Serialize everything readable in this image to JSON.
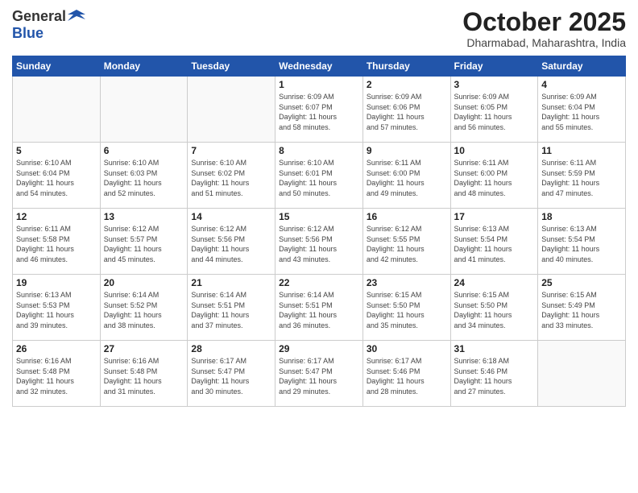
{
  "header": {
    "logo_general": "General",
    "logo_blue": "Blue",
    "month_title": "October 2025",
    "location": "Dharmabad, Maharashtra, India"
  },
  "calendar": {
    "days_of_week": [
      "Sunday",
      "Monday",
      "Tuesday",
      "Wednesday",
      "Thursday",
      "Friday",
      "Saturday"
    ],
    "weeks": [
      [
        {
          "day": "",
          "info": ""
        },
        {
          "day": "",
          "info": ""
        },
        {
          "day": "",
          "info": ""
        },
        {
          "day": "1",
          "info": "Sunrise: 6:09 AM\nSunset: 6:07 PM\nDaylight: 11 hours\nand 58 minutes."
        },
        {
          "day": "2",
          "info": "Sunrise: 6:09 AM\nSunset: 6:06 PM\nDaylight: 11 hours\nand 57 minutes."
        },
        {
          "day": "3",
          "info": "Sunrise: 6:09 AM\nSunset: 6:05 PM\nDaylight: 11 hours\nand 56 minutes."
        },
        {
          "day": "4",
          "info": "Sunrise: 6:09 AM\nSunset: 6:04 PM\nDaylight: 11 hours\nand 55 minutes."
        }
      ],
      [
        {
          "day": "5",
          "info": "Sunrise: 6:10 AM\nSunset: 6:04 PM\nDaylight: 11 hours\nand 54 minutes."
        },
        {
          "day": "6",
          "info": "Sunrise: 6:10 AM\nSunset: 6:03 PM\nDaylight: 11 hours\nand 52 minutes."
        },
        {
          "day": "7",
          "info": "Sunrise: 6:10 AM\nSunset: 6:02 PM\nDaylight: 11 hours\nand 51 minutes."
        },
        {
          "day": "8",
          "info": "Sunrise: 6:10 AM\nSunset: 6:01 PM\nDaylight: 11 hours\nand 50 minutes."
        },
        {
          "day": "9",
          "info": "Sunrise: 6:11 AM\nSunset: 6:00 PM\nDaylight: 11 hours\nand 49 minutes."
        },
        {
          "day": "10",
          "info": "Sunrise: 6:11 AM\nSunset: 6:00 PM\nDaylight: 11 hours\nand 48 minutes."
        },
        {
          "day": "11",
          "info": "Sunrise: 6:11 AM\nSunset: 5:59 PM\nDaylight: 11 hours\nand 47 minutes."
        }
      ],
      [
        {
          "day": "12",
          "info": "Sunrise: 6:11 AM\nSunset: 5:58 PM\nDaylight: 11 hours\nand 46 minutes."
        },
        {
          "day": "13",
          "info": "Sunrise: 6:12 AM\nSunset: 5:57 PM\nDaylight: 11 hours\nand 45 minutes."
        },
        {
          "day": "14",
          "info": "Sunrise: 6:12 AM\nSunset: 5:56 PM\nDaylight: 11 hours\nand 44 minutes."
        },
        {
          "day": "15",
          "info": "Sunrise: 6:12 AM\nSunset: 5:56 PM\nDaylight: 11 hours\nand 43 minutes."
        },
        {
          "day": "16",
          "info": "Sunrise: 6:12 AM\nSunset: 5:55 PM\nDaylight: 11 hours\nand 42 minutes."
        },
        {
          "day": "17",
          "info": "Sunrise: 6:13 AM\nSunset: 5:54 PM\nDaylight: 11 hours\nand 41 minutes."
        },
        {
          "day": "18",
          "info": "Sunrise: 6:13 AM\nSunset: 5:54 PM\nDaylight: 11 hours\nand 40 minutes."
        }
      ],
      [
        {
          "day": "19",
          "info": "Sunrise: 6:13 AM\nSunset: 5:53 PM\nDaylight: 11 hours\nand 39 minutes."
        },
        {
          "day": "20",
          "info": "Sunrise: 6:14 AM\nSunset: 5:52 PM\nDaylight: 11 hours\nand 38 minutes."
        },
        {
          "day": "21",
          "info": "Sunrise: 6:14 AM\nSunset: 5:51 PM\nDaylight: 11 hours\nand 37 minutes."
        },
        {
          "day": "22",
          "info": "Sunrise: 6:14 AM\nSunset: 5:51 PM\nDaylight: 11 hours\nand 36 minutes."
        },
        {
          "day": "23",
          "info": "Sunrise: 6:15 AM\nSunset: 5:50 PM\nDaylight: 11 hours\nand 35 minutes."
        },
        {
          "day": "24",
          "info": "Sunrise: 6:15 AM\nSunset: 5:50 PM\nDaylight: 11 hours\nand 34 minutes."
        },
        {
          "day": "25",
          "info": "Sunrise: 6:15 AM\nSunset: 5:49 PM\nDaylight: 11 hours\nand 33 minutes."
        }
      ],
      [
        {
          "day": "26",
          "info": "Sunrise: 6:16 AM\nSunset: 5:48 PM\nDaylight: 11 hours\nand 32 minutes."
        },
        {
          "day": "27",
          "info": "Sunrise: 6:16 AM\nSunset: 5:48 PM\nDaylight: 11 hours\nand 31 minutes."
        },
        {
          "day": "28",
          "info": "Sunrise: 6:17 AM\nSunset: 5:47 PM\nDaylight: 11 hours\nand 30 minutes."
        },
        {
          "day": "29",
          "info": "Sunrise: 6:17 AM\nSunset: 5:47 PM\nDaylight: 11 hours\nand 29 minutes."
        },
        {
          "day": "30",
          "info": "Sunrise: 6:17 AM\nSunset: 5:46 PM\nDaylight: 11 hours\nand 28 minutes."
        },
        {
          "day": "31",
          "info": "Sunrise: 6:18 AM\nSunset: 5:46 PM\nDaylight: 11 hours\nand 27 minutes."
        },
        {
          "day": "",
          "info": ""
        }
      ]
    ]
  }
}
